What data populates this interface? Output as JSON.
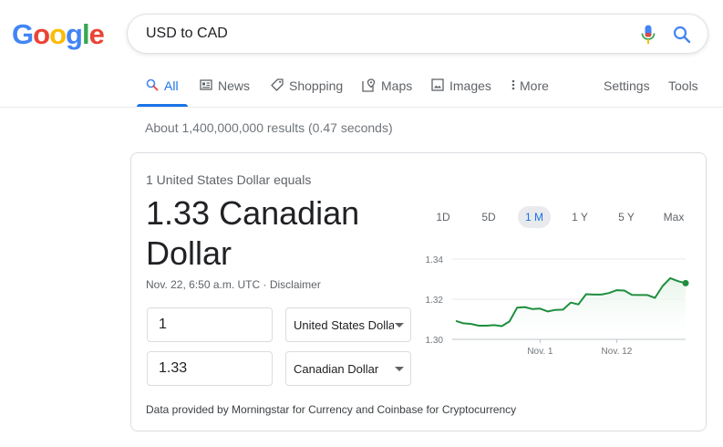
{
  "logo": {
    "letters": [
      "G",
      "o",
      "o",
      "g",
      "l",
      "e"
    ],
    "colors": [
      "#4285F4",
      "#EA4335",
      "#FBBC05",
      "#4285F4",
      "#34A853",
      "#EA4335"
    ]
  },
  "search": {
    "value": "USD to CAD",
    "mic_icon": "mic-icon",
    "search_icon": "search-icon"
  },
  "tabs": [
    {
      "label": "All",
      "icon": "search-icon",
      "active": true
    },
    {
      "label": "News",
      "icon": "news-icon"
    },
    {
      "label": "Shopping",
      "icon": "tag-icon"
    },
    {
      "label": "Maps",
      "icon": "map-pin-icon"
    },
    {
      "label": "Images",
      "icon": "image-icon"
    },
    {
      "label": "More",
      "icon": "more-vert-icon"
    }
  ],
  "tools": {
    "settings": "Settings",
    "tools": "Tools"
  },
  "result_stats": "About 1,400,000,000 results (0.47 seconds)",
  "converter": {
    "equals_label": "1 United States Dollar equals",
    "value": "1.33 Canadian Dollar",
    "timestamp": "Nov. 22, 6:50 a.m. UTC · ",
    "disclaimer": "Disclaimer",
    "from_amount": "1",
    "from_currency": "United States Dollar",
    "to_amount": "1.33",
    "to_currency": "Canadian Dollar",
    "ranges": [
      "1D",
      "5D",
      "1 M",
      "1 Y",
      "5 Y",
      "Max"
    ],
    "active_range": "1 M",
    "footer": "Data provided by Morningstar for Currency and Coinbase for Cryptocurrency"
  },
  "colors": {
    "accent": "#1a73e8",
    "line": "#1e8e3e",
    "fill": "#e6f4ea"
  },
  "chart_data": {
    "type": "area",
    "xlabel": "",
    "ylabel": "",
    "ylim": [
      1.3,
      1.34
    ],
    "yticks": [
      1.34,
      1.32,
      1.3
    ],
    "xticks": [
      "Nov. 1",
      "Nov. 12"
    ],
    "grid": true,
    "series": [
      {
        "x": [
          0,
          1,
          2,
          3,
          4,
          5,
          6,
          7,
          8,
          9,
          10,
          11,
          12,
          13,
          14,
          15,
          16,
          17,
          18,
          19,
          20,
          21,
          22,
          23,
          24,
          25,
          26,
          27,
          28,
          29,
          30
        ],
        "values": [
          1.3092,
          1.308,
          1.3077,
          1.3068,
          1.3068,
          1.3071,
          1.3066,
          1.3089,
          1.3158,
          1.3161,
          1.3151,
          1.3153,
          1.3139,
          1.3147,
          1.3148,
          1.3183,
          1.3174,
          1.3225,
          1.3223,
          1.3223,
          1.3231,
          1.3245,
          1.3243,
          1.3222,
          1.3221,
          1.3221,
          1.3207,
          1.3266,
          1.3305,
          1.329,
          1.328
        ]
      }
    ]
  }
}
